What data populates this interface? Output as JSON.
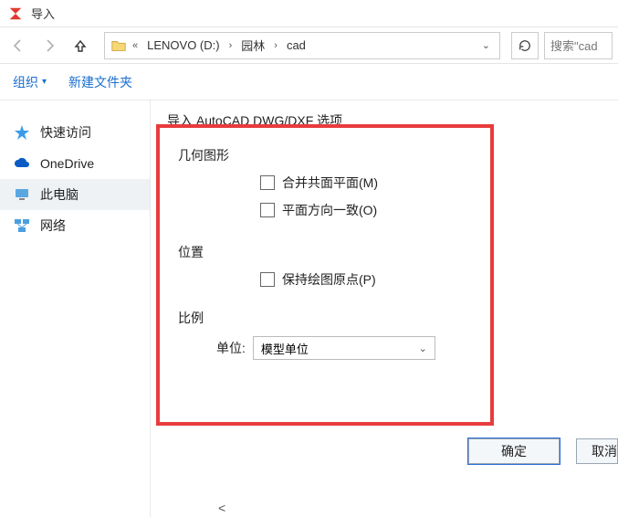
{
  "window": {
    "title": "导入"
  },
  "nav": {
    "drive": "LENOVO (D:)",
    "folder1": "园林",
    "folder2": "cad",
    "search_placeholder": "搜索\"cad"
  },
  "toolbar": {
    "organize": "组织",
    "new_folder": "新建文件夹"
  },
  "sidebar": {
    "items": [
      {
        "label": "快速访问"
      },
      {
        "label": "OneDrive"
      },
      {
        "label": "此电脑"
      },
      {
        "label": "网络"
      }
    ]
  },
  "dialog": {
    "title": "导入 AutoCAD DWG/DXF 选项",
    "geometry_label": "几何图形",
    "merge_coplanar": "合并共面平面(M)",
    "orient_consistent": "平面方向一致(O)",
    "position_label": "位置",
    "preserve_origin": "保持绘图原点(P)",
    "scale_label": "比例",
    "unit_label": "单位:",
    "unit_value": "模型单位",
    "ok": "确定",
    "cancel": "取消"
  },
  "scroll_hint": "<"
}
